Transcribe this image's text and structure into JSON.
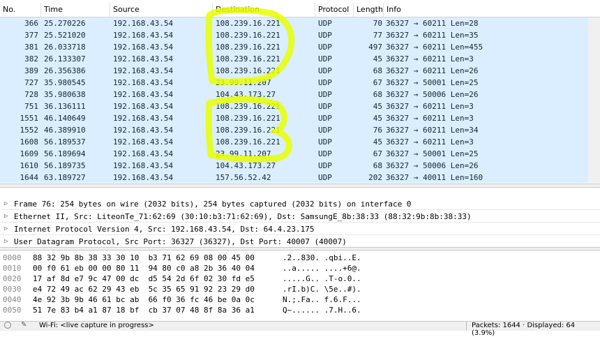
{
  "columns": [
    "No.",
    "Time",
    "Source",
    "Destination",
    "Protocol",
    "Length",
    "Info"
  ],
  "packets": [
    {
      "no": "366",
      "time": "25.270226",
      "src": "192.168.43.54",
      "dst": "108.239.16.221",
      "proto": "UDP",
      "len": "70",
      "info": "36327 → 60211  Len=28"
    },
    {
      "no": "377",
      "time": "25.521020",
      "src": "192.168.43.54",
      "dst": "108.239.16.221",
      "proto": "UDP",
      "len": "77",
      "info": "36327 → 60211  Len=35"
    },
    {
      "no": "381",
      "time": "26.033718",
      "src": "192.168.43.54",
      "dst": "108.239.16.221",
      "proto": "UDP",
      "len": "497",
      "info": "36327 → 60211  Len=455"
    },
    {
      "no": "382",
      "time": "26.133307",
      "src": "192.168.43.54",
      "dst": "108.239.16.221",
      "proto": "UDP",
      "len": "45",
      "info": "36327 → 60211  Len=3"
    },
    {
      "no": "389",
      "time": "26.356386",
      "src": "192.168.43.54",
      "dst": "108.239.16.221",
      "proto": "UDP",
      "len": "68",
      "info": "36327 → 60211  Len=26"
    },
    {
      "no": "727",
      "time": "35.980545",
      "src": "192.168.43.54",
      "dst": "23.99.11.207",
      "proto": "UDP",
      "len": "67",
      "info": "36327 → 50001  Len=25"
    },
    {
      "no": "728",
      "time": "35.980638",
      "src": "192.168.43.54",
      "dst": "104.43.173.27",
      "proto": "UDP",
      "len": "68",
      "info": "36327 → 50006  Len=26"
    },
    {
      "no": "751",
      "time": "36.136111",
      "src": "192.168.43.54",
      "dst": "108.239.16.221",
      "proto": "UDP",
      "len": "45",
      "info": "36327 → 60211  Len=3"
    },
    {
      "no": "1551",
      "time": "46.140649",
      "src": "192.168.43.54",
      "dst": "108.239.16.221",
      "proto": "UDP",
      "len": "45",
      "info": "36327 → 60211  Len=3"
    },
    {
      "no": "1552",
      "time": "46.389910",
      "src": "192.168.43.54",
      "dst": "108.239.16.221",
      "proto": "UDP",
      "len": "76",
      "info": "36327 → 60211  Len=34"
    },
    {
      "no": "1608",
      "time": "56.189537",
      "src": "192.168.43.54",
      "dst": "108.239.16.221",
      "proto": "UDP",
      "len": "45",
      "info": "36327 → 60211  Len=3"
    },
    {
      "no": "1609",
      "time": "56.189694",
      "src": "192.168.43.54",
      "dst": "23.99.11.207",
      "proto": "UDP",
      "len": "67",
      "info": "36327 → 50001  Len=25"
    },
    {
      "no": "1610",
      "time": "56.189735",
      "src": "192.168.43.54",
      "dst": "104.43.173.27",
      "proto": "UDP",
      "len": "68",
      "info": "36327 → 50006  Len=26"
    },
    {
      "no": "1644",
      "time": "63.189727",
      "src": "192.168.43.54",
      "dst": "157.56.52.42",
      "proto": "UDP",
      "len": "202",
      "info": "36327 → 40011  Len=160"
    }
  ],
  "details": [
    "Frame 76: 254 bytes on wire (2032 bits), 254 bytes captured (2032 bits) on interface 0",
    "Ethernet II, Src: LiteonTe_71:62:69 (30:10:b3:71:62:69), Dst: SamsungE_8b:38:33 (88:32:9b:8b:38:33)",
    "Internet Protocol Version 4, Src: 192.168.43.54, Dst: 64.4.23.175",
    "User Datagram Protocol, Src Port: 36327 (36327), Dst Port: 40007 (40007)"
  ],
  "hex_rows": [
    {
      "offset": "0000",
      "hex": "88 32 9b 8b 38 33 30 10  b3 71 62 69 08 00 45 00",
      "ascii": ".2..830. .qbi..E."
    },
    {
      "offset": "0010",
      "hex": "00 f0 61 eb 00 00 80 11  94 80 c0 a8 2b 36 40 04",
      "ascii": "..a..... ....+6@."
    },
    {
      "offset": "0020",
      "hex": "17 af 8d e7 9c 47 00 dc  d5 54 2d 6f 02 30 fd e5",
      "ascii": ".....G.. .T-o.0.."
    },
    {
      "offset": "0030",
      "hex": "e4 72 49 ac 62 29 43 eb  5c 35 65 91 92 23 29 d0",
      "ascii": ".rI.b)C. \\5e..#)."
    },
    {
      "offset": "0040",
      "hex": "4e 92 3b 9b 46 61 bc ab  66 f0 36 fc 46 be 0a 0c",
      "ascii": "N.;.Fa.. f.6.F..."
    },
    {
      "offset": "0050",
      "hex": "51 7e 83 b4 a1 87 18 bf  cb 37 07 48 8f 8a 36 a1",
      "ascii": "Q~...... .7.H..6."
    }
  ],
  "status": {
    "capture": "Wi-Fi: <live capture in progress>",
    "packets": "Packets: 1644 · Displayed: 64 (3.9%)"
  },
  "colors": {
    "row_bg": "#daeeff",
    "highlight": "#e8ff00"
  }
}
